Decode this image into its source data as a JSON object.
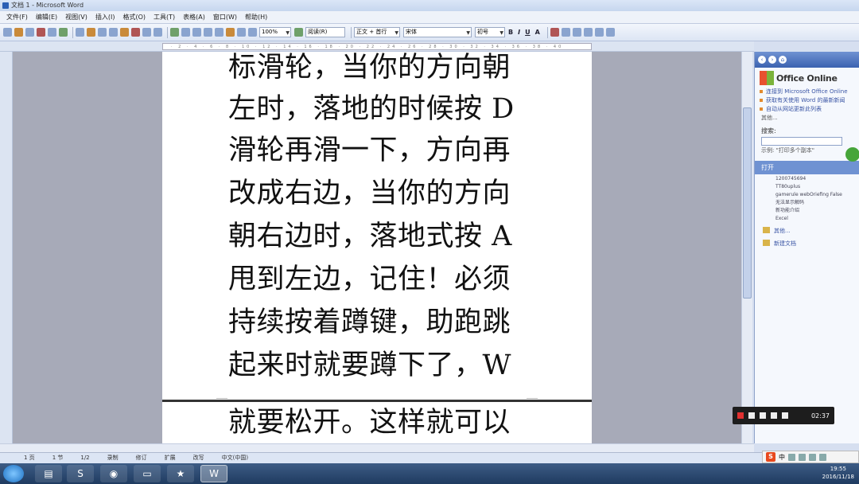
{
  "window": {
    "title": "文档 1 - Microsoft Word"
  },
  "menu": [
    "文件(F)",
    "编辑(E)",
    "视图(V)",
    "插入(I)",
    "格式(O)",
    "工具(T)",
    "表格(A)",
    "窗口(W)",
    "帮助(H)"
  ],
  "toolbar": {
    "zoom": "100%",
    "read": "阅读(R)",
    "style": "正文 + 首行",
    "font": "宋体",
    "size": "初号",
    "bold": "B",
    "italic": "I",
    "underline": "U",
    "charscale": "A"
  },
  "document": {
    "page1_lines": [
      "标滑轮，当你的方向朝",
      "左时，落地的时候按 D",
      "滑轮再滑一下，方向再",
      "改成右边，当你的方向",
      "朝右边时，落地式按 A",
      "甩到左边，记住！必须",
      "持续按着蹲键，助跑跳",
      "起来时就要蹲下了，W"
    ],
    "page2_lines": [
      "就要松开。这样就可以"
    ]
  },
  "taskpane": {
    "logo": "Office Online",
    "links": [
      "连接到 Microsoft Office Online",
      "获取有关使用 Word 的最新新闻",
      "自动从网站更新此列表"
    ],
    "more": "其他...",
    "search_label": "搜索:",
    "example": "示例:  \"打印多个副本\"",
    "open_section": "打开",
    "files": [
      "1200745694",
      "TT80uplus",
      "gamerule webOriefing False",
      "无法显示解码",
      "新功能介绍",
      "Excel"
    ],
    "open_more": "其他...",
    "new_doc": "新建文档"
  },
  "recorder": {
    "time": "02:37"
  },
  "status": {
    "page": "1 页",
    "section": "1 节",
    "pages": "1/2",
    "rec": "录制",
    "rev": "修订",
    "ext": "扩展",
    "ovr": "改写",
    "lang": "中文(中国)"
  },
  "taskbar": {
    "time": "19:55",
    "date": "2016/11/18",
    "ime": "中"
  },
  "colors": {
    "accent": "#3b62b0",
    "page": "#ffffff",
    "workspace": "#a7aab8"
  }
}
